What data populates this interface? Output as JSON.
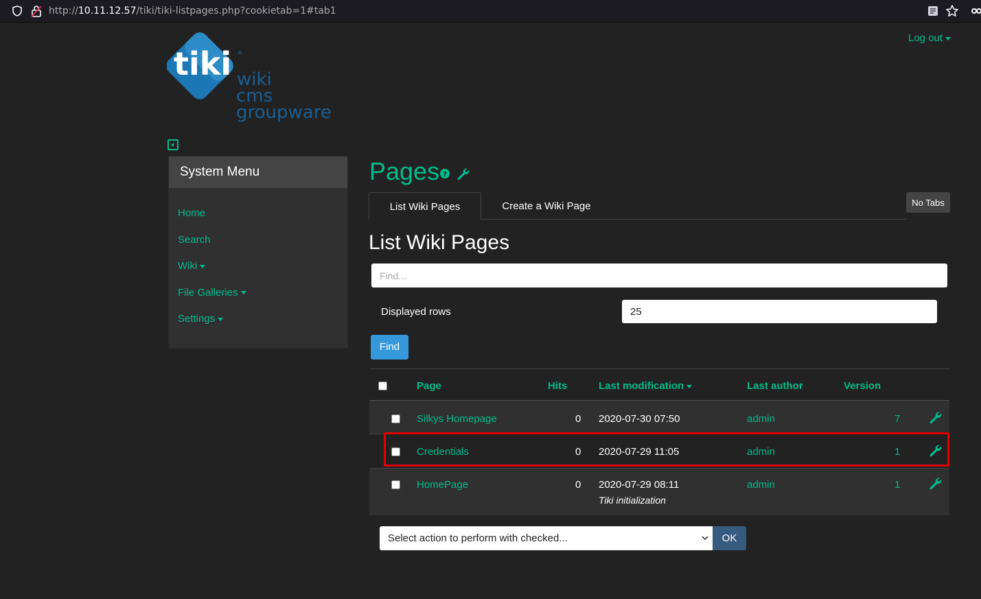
{
  "browser": {
    "url_prefix": "http://",
    "url_host": "10.11.12.57",
    "url_path": "/tiki/tiki-listpages.php?cookietab=1#tab1"
  },
  "header": {
    "logout_label": "Log out",
    "logo_word": "tiki",
    "logo_tag1": "wiki",
    "logo_tag2": "cms",
    "logo_tag3": "groupware"
  },
  "sidebar": {
    "title": "System Menu",
    "items": [
      {
        "label": "Home",
        "dropdown": false
      },
      {
        "label": "Search",
        "dropdown": false
      },
      {
        "label": "Wiki",
        "dropdown": true
      },
      {
        "label": "File Galleries",
        "dropdown": true
      },
      {
        "label": "Settings",
        "dropdown": true
      }
    ]
  },
  "main": {
    "page_title": "Pages",
    "tabs": [
      "List Wiki Pages",
      "Create a Wiki Page"
    ],
    "no_tabs_label": "No Tabs",
    "heading": "List Wiki Pages",
    "find_placeholder": "Find...",
    "displayed_rows_label": "Displayed rows",
    "displayed_rows_value": "25",
    "find_button": "Find",
    "table": {
      "headers": {
        "page": "Page",
        "hits": "Hits",
        "last_modification": "Last modification",
        "last_author": "Last author",
        "version": "Version"
      },
      "rows": [
        {
          "page": "Silkys Homepage",
          "hits": "0",
          "modified": "2020-07-30 07:50",
          "note": "",
          "author": "admin",
          "version": "7"
        },
        {
          "page": "Credentials",
          "hits": "0",
          "modified": "2020-07-29 11:05",
          "note": "",
          "author": "admin",
          "version": "1"
        },
        {
          "page": "HomePage",
          "hits": "0",
          "modified": "2020-07-29 08:11",
          "note": "Tiki initialization",
          "author": "admin",
          "version": "1"
        }
      ]
    },
    "action_select": "Select action to perform with checked...",
    "ok_button": "OK"
  },
  "colors": {
    "accent": "#00bc8c",
    "background": "#222222",
    "primary_button": "#3498db",
    "ok_button": "#375a7f",
    "highlight": "#e00000"
  }
}
